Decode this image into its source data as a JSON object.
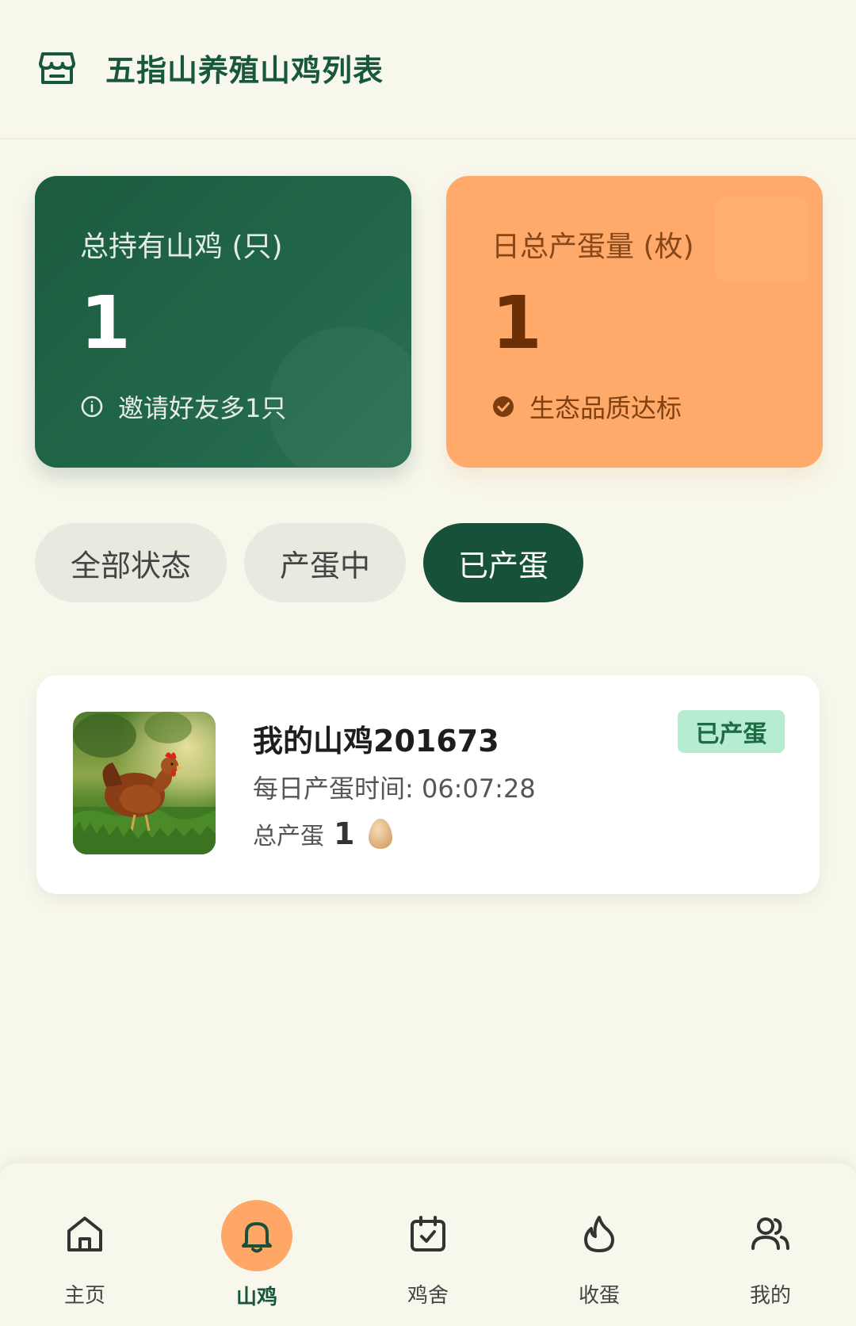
{
  "header": {
    "title": "五指山养殖山鸡列表",
    "icon": "store-icon"
  },
  "stats": {
    "total_chickens": {
      "label": "总持有山鸡 (只)",
      "value": "1",
      "note": "邀请好友多1只",
      "note_icon": "info-icon",
      "color": "#1b5b3e"
    },
    "daily_eggs": {
      "label": "日总产蛋量 (枚)",
      "value": "1",
      "note": "生态品质达标",
      "note_icon": "check-circle-icon",
      "color": "#ffaa6a"
    }
  },
  "filters": [
    {
      "label": "全部状态",
      "active": false
    },
    {
      "label": "产蛋中",
      "active": false
    },
    {
      "label": "已产蛋",
      "active": true
    }
  ],
  "chickens": [
    {
      "name": "我的山鸡201673",
      "daily_time": "每日产蛋时间: 06:07:28",
      "total_label": "总产蛋",
      "total_value": "1",
      "status": "已产蛋",
      "status_color": "#b6ecd0"
    }
  ],
  "nav": [
    {
      "label": "主页",
      "icon": "home-icon",
      "active": false
    },
    {
      "label": "山鸡",
      "icon": "bell-icon",
      "active": true
    },
    {
      "label": "鸡舍",
      "icon": "calendar-check-icon",
      "active": false
    },
    {
      "label": "收蛋",
      "icon": "flame-icon",
      "active": false
    },
    {
      "label": "我的",
      "icon": "users-icon",
      "active": false
    }
  ],
  "colors": {
    "primary": "#17583c",
    "accent": "#ffa766",
    "background": "#f8f7ec"
  }
}
